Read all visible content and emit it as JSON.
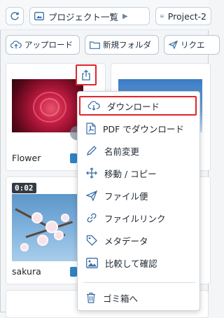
{
  "header": {
    "breadcrumb": [
      "プロジェクト一覧",
      "Project-2"
    ]
  },
  "toolbar": {
    "upload_label": "アップロード",
    "new_folder_label": "新規フォルダ",
    "request_label": "リクエ"
  },
  "files": [
    {
      "name": "Flower"
    },
    {
      "name": "sakura",
      "duration": "0:02"
    }
  ],
  "context_menu": {
    "items": [
      {
        "label": "ダウンロード",
        "icon": "cloud-download-icon",
        "highlighted": true
      },
      {
        "label": "PDF でダウンロード",
        "icon": "pdf-icon"
      },
      {
        "label": "名前変更",
        "icon": "pencil-icon"
      },
      {
        "label": "移動 / コピー",
        "icon": "move-icon"
      },
      {
        "label": "ファイル便",
        "icon": "paper-plane-icon"
      },
      {
        "label": "ファイルリンク",
        "icon": "link-icon"
      },
      {
        "label": "メタデータ",
        "icon": "tag-icon"
      },
      {
        "label": "比較して確認",
        "icon": "compare-image-icon"
      },
      {
        "label": "ゴミ箱へ",
        "icon": "trash-icon"
      }
    ]
  },
  "colors": {
    "accent": "#2d84c4",
    "highlight_border": "#e0242b",
    "icon_blue": "#3a6ea5"
  }
}
